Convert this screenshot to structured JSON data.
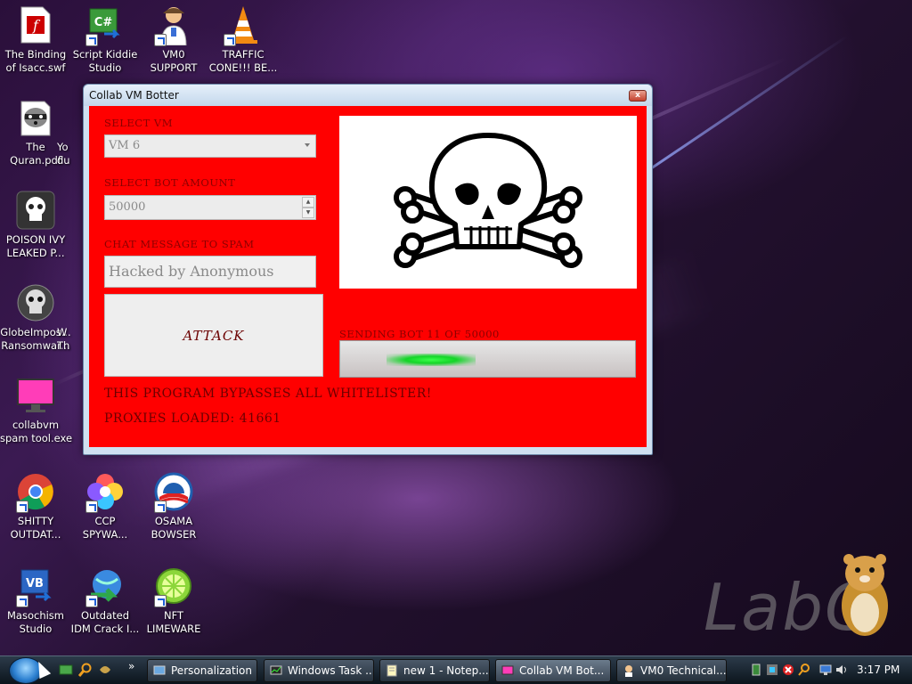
{
  "desktop": {
    "icons": [
      {
        "label": "The Binding\nof Isacc.swf",
        "icon": "flash-file-icon"
      },
      {
        "label": "Script Kiddie\nStudio",
        "icon": "csharp-studio-icon"
      },
      {
        "label": "VM0\nSUPPORT",
        "icon": "doctor-icon"
      },
      {
        "label": "TRAFFIC\nCONE!!! BE...",
        "icon": "traffic-cone-icon"
      },
      {
        "label": "The\nQuran.pdf",
        "icon": "raccoon-icon"
      },
      {
        "label": "Yo\ndu",
        "icon": "partial-icon"
      },
      {
        "label": "POISON IVY\nLEAKED P...",
        "icon": "skull-icon"
      },
      {
        "label": "GlobeImpos...\nRansomwar...",
        "icon": "skull-icon"
      },
      {
        "label": "W\nTh",
        "icon": "partial-icon"
      },
      {
        "label": "collabvm\nspam tool.exe",
        "icon": "monitor-icon"
      },
      {
        "label": "SHITTY\nOUTDAT...",
        "icon": "chrome-icon"
      },
      {
        "label": "CCP\nSPYWA...",
        "icon": "pinwheel-icon"
      },
      {
        "label": "OSAMA\nBOWSER",
        "icon": "obama-logo-icon"
      },
      {
        "label": "Masochism\nStudio",
        "icon": "vb-studio-icon"
      },
      {
        "label": "Outdated\nIDM Crack I...",
        "icon": "globe-download-icon"
      },
      {
        "label": "NFT\nLIMEWARE",
        "icon": "lime-icon"
      }
    ],
    "watermark": "LabC"
  },
  "window": {
    "title": "Collab VM Botter",
    "close_label": "x",
    "select_vm_label": "SELECT VM",
    "select_vm_value": "VM 6",
    "bot_amount_label": "SELECT BOT AMOUNT",
    "bot_amount_value": "50000",
    "chat_label": "CHAT MESSAGE TO SPAM",
    "chat_value": "Hacked by Anonymous",
    "attack_label": "ATTACK",
    "sending_text": "SENDING BOT 11 OF 50000",
    "progress_fraction": 0.00022,
    "bypass_text": "THIS PROGRAM BYPASSES ALL WHITELISTER!",
    "proxies_text": "PROXIES LOADED: 41661",
    "image_icon": "skull-crossbones-icon",
    "accent_color": "#ff0000"
  },
  "taskbar": {
    "tasks": [
      {
        "label": "Personalization",
        "icon": "personalization-icon"
      },
      {
        "label": "Windows Task ...",
        "icon": "task-manager-icon"
      },
      {
        "label": "new 1 - Notep...",
        "icon": "notepad-icon"
      },
      {
        "label": "Collab VM Bot...",
        "icon": "app-icon"
      },
      {
        "label": "VM0 Technical...",
        "icon": "support-icon"
      }
    ],
    "overflow_label": "»",
    "clock": "3:17 PM"
  }
}
